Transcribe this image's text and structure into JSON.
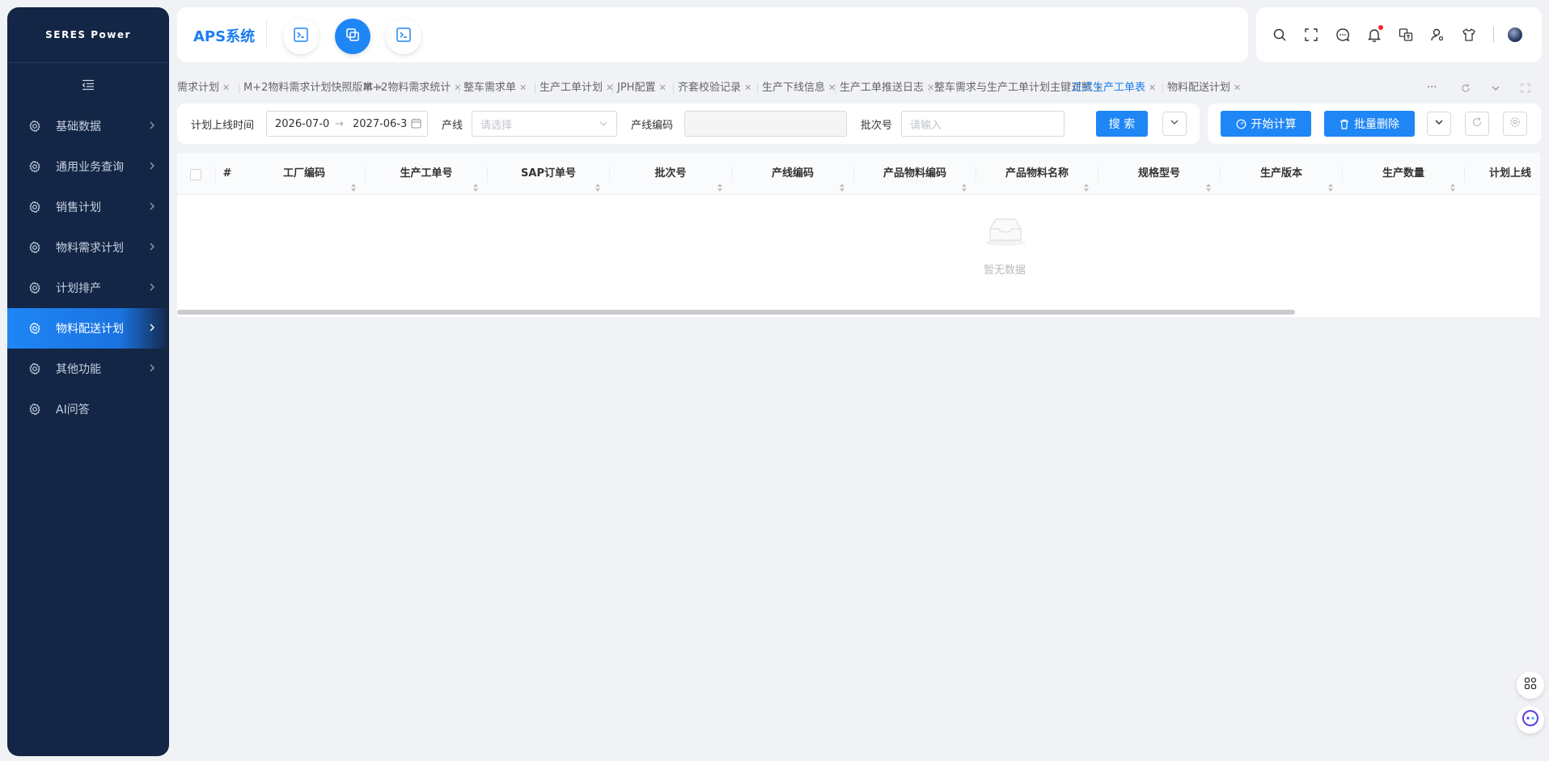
{
  "brand": "SERES Power",
  "app_title": "APS系统",
  "sidebar": {
    "items": [
      {
        "label": "基础数据"
      },
      {
        "label": "通用业务查询"
      },
      {
        "label": "销售计划"
      },
      {
        "label": "物料需求计划"
      },
      {
        "label": "计划排产"
      },
      {
        "label": "物料配送计划",
        "active": true
      },
      {
        "label": "其他功能"
      },
      {
        "label": "AI问答"
      }
    ]
  },
  "toolbar_icons": [
    "search-icon",
    "fullscreen-icon",
    "message-icon",
    "bell-icon",
    "translate-icon",
    "user-settings-icon",
    "theme-shirt-icon"
  ],
  "tabs": [
    {
      "label": "需求计划"
    },
    {
      "label": "M+2物料需求计划快照版本"
    },
    {
      "label": "M+2物料需求统计"
    },
    {
      "label": "整车需求单"
    },
    {
      "label": "生产工单计划"
    },
    {
      "label": "JPH配置"
    },
    {
      "label": "齐套校验记录"
    },
    {
      "label": "生产下线信息"
    },
    {
      "label": "生产工单推送日志"
    },
    {
      "label": "整车需求与生产工单计划主键对照"
    },
    {
      "label": "正式生产工单表",
      "active": true
    },
    {
      "label": "物料配送计划"
    }
  ],
  "tabs_more": "···",
  "search": {
    "plan_time_label": "计划上线时间",
    "date_start": "2026-07-0",
    "date_sep": "→",
    "date_end": "2027-06-3",
    "line_label": "产线",
    "line_placeholder": "请选择",
    "line_code_label": "产线编码",
    "batch_label": "批次号",
    "batch_placeholder": "请输入",
    "search_button": "搜 索"
  },
  "actions": {
    "start_calc": "开始计算",
    "batch_delete": "批量删除"
  },
  "table": {
    "columns": [
      "#",
      "工厂编码",
      "生产工单号",
      "SAP订单号",
      "批次号",
      "产线编码",
      "产品物料编码",
      "产品物料名称",
      "规格型号",
      "生产版本",
      "生产数量",
      "计划上线"
    ],
    "empty_text": "暂无数据"
  },
  "colors": {
    "primary": "#1f86f5",
    "sidebar_bg": "#142645",
    "page_bg": "#f0f2f5"
  }
}
